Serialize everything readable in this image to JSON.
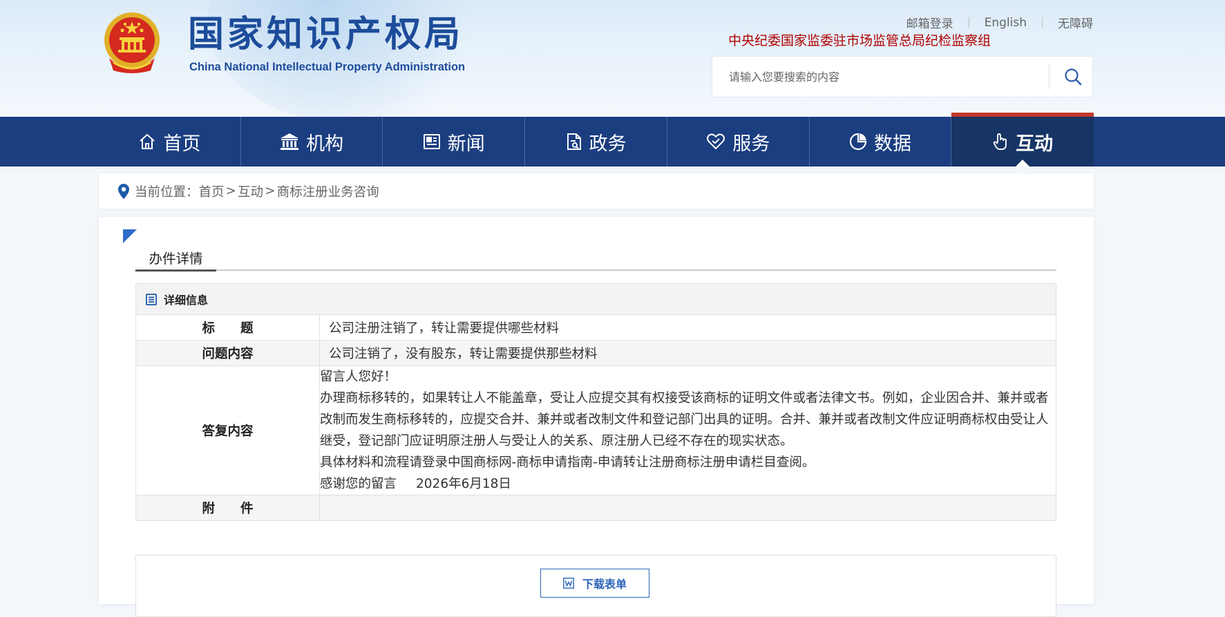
{
  "header": {
    "logo_cn": "国家知识产权局",
    "logo_en": "China National Intellectual Property Administration",
    "links": [
      "邮箱登录",
      "English",
      "无障碍"
    ],
    "supervision": "中央纪委国家监委驻市场监管总局纪检监察组",
    "search_placeholder": "请输入您要搜索的内容"
  },
  "nav": [
    {
      "label": "首页",
      "icon": "home-icon"
    },
    {
      "label": "机构",
      "icon": "institution-icon"
    },
    {
      "label": "新闻",
      "icon": "newspaper-icon"
    },
    {
      "label": "政务",
      "icon": "document-icon"
    },
    {
      "label": "服务",
      "icon": "service-icon"
    },
    {
      "label": "数据",
      "icon": "pie-chart-icon"
    },
    {
      "label": "互动",
      "icon": "hand-pointer-icon",
      "active": true
    }
  ],
  "breadcrumb": {
    "prefix": "当前位置：",
    "items": [
      "首页",
      "互动",
      "商标注册业务咨询"
    ],
    "separator": ">"
  },
  "section_tab": "办件详情",
  "detail": {
    "header": "详细信息",
    "title_label": "标　　题",
    "title_value": "公司注册注销了，转让需要提供哪些材料",
    "question_label": "问题内容",
    "question_value": "公司注销了，没有股东，转让需要提供那些材料",
    "answer_label": "答复内容",
    "answer_lines": [
      "留言人您好！",
      "办理商标移转的，如果转让人不能盖章，受让人应提交其有权接受该商标的证明文件或者法律文书。例如，企业因合并、兼并或者改制而发生商标移转的，应提交合并、兼并或者改制文件和登记部门出具的证明。合并、兼并或者改制文件应证明商标权由受让人继受，登记部门应证明原注册人与受让人的关系、原注册人已经不存在的现实状态。",
      "具体材料和流程请登录中国商标网-商标申请指南-申请转让注册商标注册申请栏目查阅。"
    ],
    "thanks": "感谢您的留言",
    "date": "2026年6月18日",
    "attachment_label": "附　　件",
    "attachment_value": ""
  },
  "download_label": "下载表单",
  "colors": {
    "nav_bg": "#1b3e80",
    "nav_active": "#163566",
    "accent_red": "#c0392b",
    "logo_blue": "#1d4c9a",
    "supervision_red": "#b00000",
    "button_blue": "#2d64b8"
  }
}
